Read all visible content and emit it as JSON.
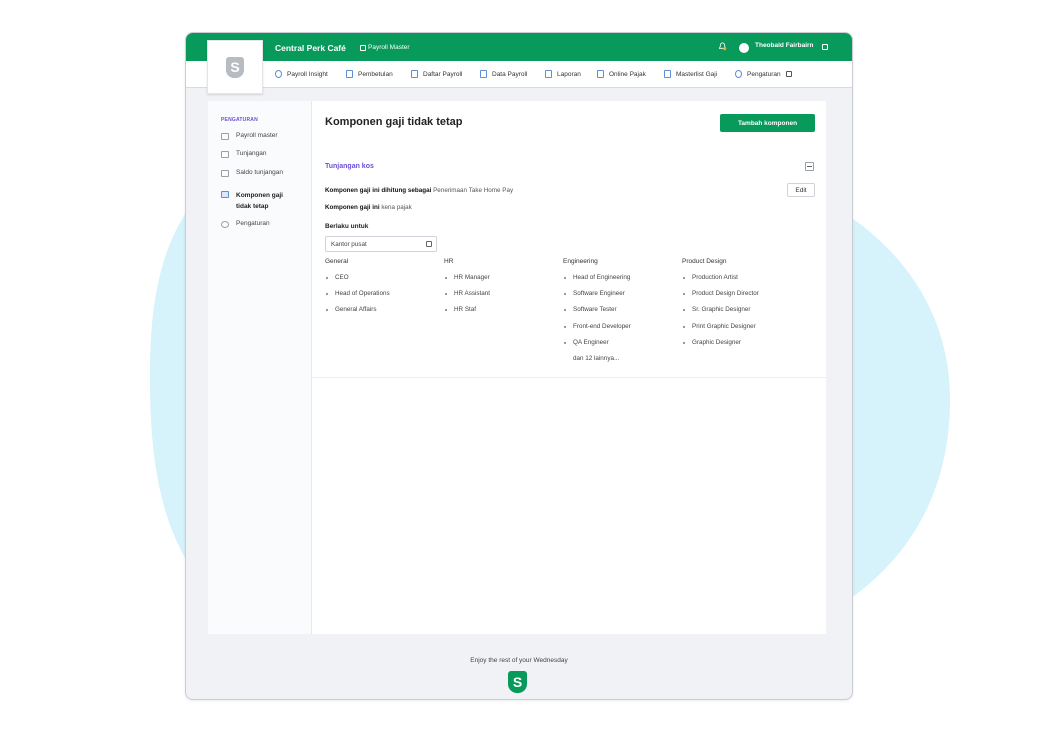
{
  "colors": {
    "brand_green": "#079a5b",
    "accent_purple": "#6b4ed8",
    "icon_blue": "#5c8fd6",
    "background_blob": "#d6f2fa"
  },
  "header": {
    "logo_letter": "S",
    "company": "Central Perk Café",
    "module": "Payroll Master",
    "user_name": "Theobald Fairbairn",
    "icons": [
      "bell-icon",
      "avatar",
      "user-menu-icon"
    ]
  },
  "nav": {
    "items": [
      {
        "label": "Payroll Insight",
        "icon": "gauge-icon"
      },
      {
        "label": "Pembetulan",
        "icon": "sliders-icon"
      },
      {
        "label": "Daftar Payroll",
        "icon": "list-icon"
      },
      {
        "label": "Data Payroll",
        "icon": "table-icon"
      },
      {
        "label": "Laporan",
        "icon": "document-icon"
      },
      {
        "label": "Online Pajak",
        "icon": "building-icon"
      },
      {
        "label": "Masterlist Gaji",
        "icon": "document-icon"
      },
      {
        "label": "Pengaturan",
        "icon": "gear-icon"
      }
    ]
  },
  "sidebar": {
    "header": "PENGATURAN",
    "items": [
      {
        "label": "Payroll master",
        "icon": "user-key-icon"
      },
      {
        "label": "Tunjangan",
        "icon": "money-stack-icon"
      },
      {
        "label": "Saldo tunjangan",
        "icon": "wallet-icon"
      },
      {
        "label": "Komponen gaji tidak tetap",
        "icon": "money-stack-icon",
        "active": true
      },
      {
        "label": "Pengaturan",
        "icon": "gear-icon"
      }
    ]
  },
  "main": {
    "title": "Komponen gaji tidak tetap",
    "add_button": "Tambah komponen",
    "section_title": "Tunjangan kos",
    "line1_label": "Komponen gaji ini dihitung sebagai",
    "line1_value": "Penerimaan Take Home Pay",
    "edit_button": "Edit",
    "line2_label": "Komponen gaji ini",
    "line2_value": "kena pajak",
    "applies_label": "Berlaku untuk",
    "office_select": "Kantor pusat",
    "departments": [
      {
        "name": "General",
        "roles": [
          "CEO",
          "Head of Operations",
          "General Affairs"
        ],
        "more": ""
      },
      {
        "name": "HR",
        "roles": [
          "HR Manager",
          "HR Assistant",
          "HR Staf"
        ],
        "more": ""
      },
      {
        "name": "Engineering",
        "roles": [
          "Head of Engineering",
          "Software Engineer",
          "Software Tester",
          "Front-end Developer",
          "QA Engineer"
        ],
        "more": "dan 12 lainnya..."
      },
      {
        "name": "Product Design",
        "roles": [
          "Production Artist",
          "Product Design Director",
          "Sr. Graphic Designer",
          "Print Graphic Designer",
          "Graphic Designer"
        ],
        "more": ""
      }
    ]
  },
  "footer": {
    "text": "Enjoy the rest of your Wednesday",
    "logo_letter": "S"
  }
}
